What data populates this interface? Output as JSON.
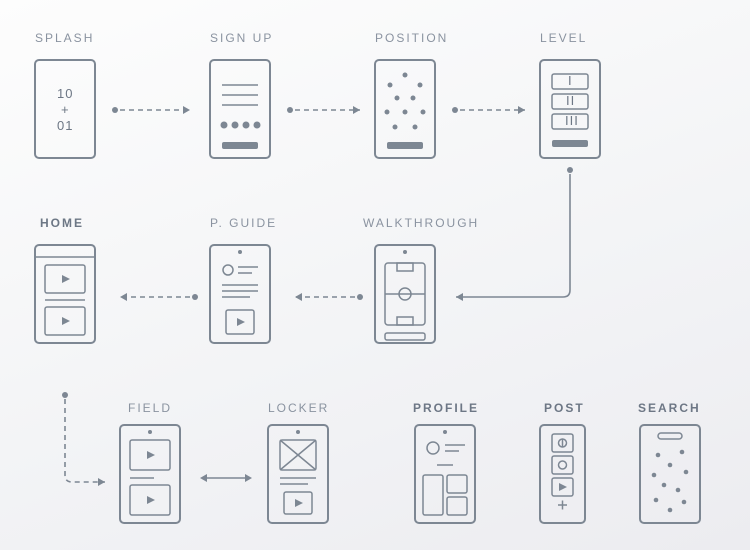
{
  "screens": {
    "splash": {
      "label": "SPLASH",
      "text_lines": [
        "10",
        "+",
        "01"
      ]
    },
    "signup": {
      "label": "SIGN UP"
    },
    "position": {
      "label": "POSITION"
    },
    "level": {
      "label": "LEVEL",
      "options": [
        "I",
        "II",
        "III"
      ]
    },
    "home": {
      "label": "HOME"
    },
    "pguide": {
      "label": "P. GUIDE"
    },
    "walkthrough": {
      "label": "WALKTHROUGH"
    },
    "field": {
      "label": "FIELD"
    },
    "locker": {
      "label": "LOCKER"
    },
    "profile": {
      "label": "PROFILE"
    },
    "post": {
      "label": "POST"
    },
    "search": {
      "label": "SEARCH"
    }
  },
  "flow": [
    {
      "from": "splash",
      "to": "signup",
      "style": "dashed",
      "dir": "right"
    },
    {
      "from": "signup",
      "to": "position",
      "style": "dashed",
      "dir": "right"
    },
    {
      "from": "position",
      "to": "level",
      "style": "dashed",
      "dir": "right"
    },
    {
      "from": "level",
      "to": "walkthrough",
      "style": "solid",
      "dir": "down-left"
    },
    {
      "from": "walkthrough",
      "to": "pguide",
      "style": "dashed",
      "dir": "left"
    },
    {
      "from": "pguide",
      "to": "home",
      "style": "dashed",
      "dir": "left"
    },
    {
      "from": "home",
      "to": "field",
      "style": "dashed",
      "dir": "down-right"
    },
    {
      "from": "field",
      "to": "locker",
      "style": "solid",
      "dir": "both"
    }
  ]
}
